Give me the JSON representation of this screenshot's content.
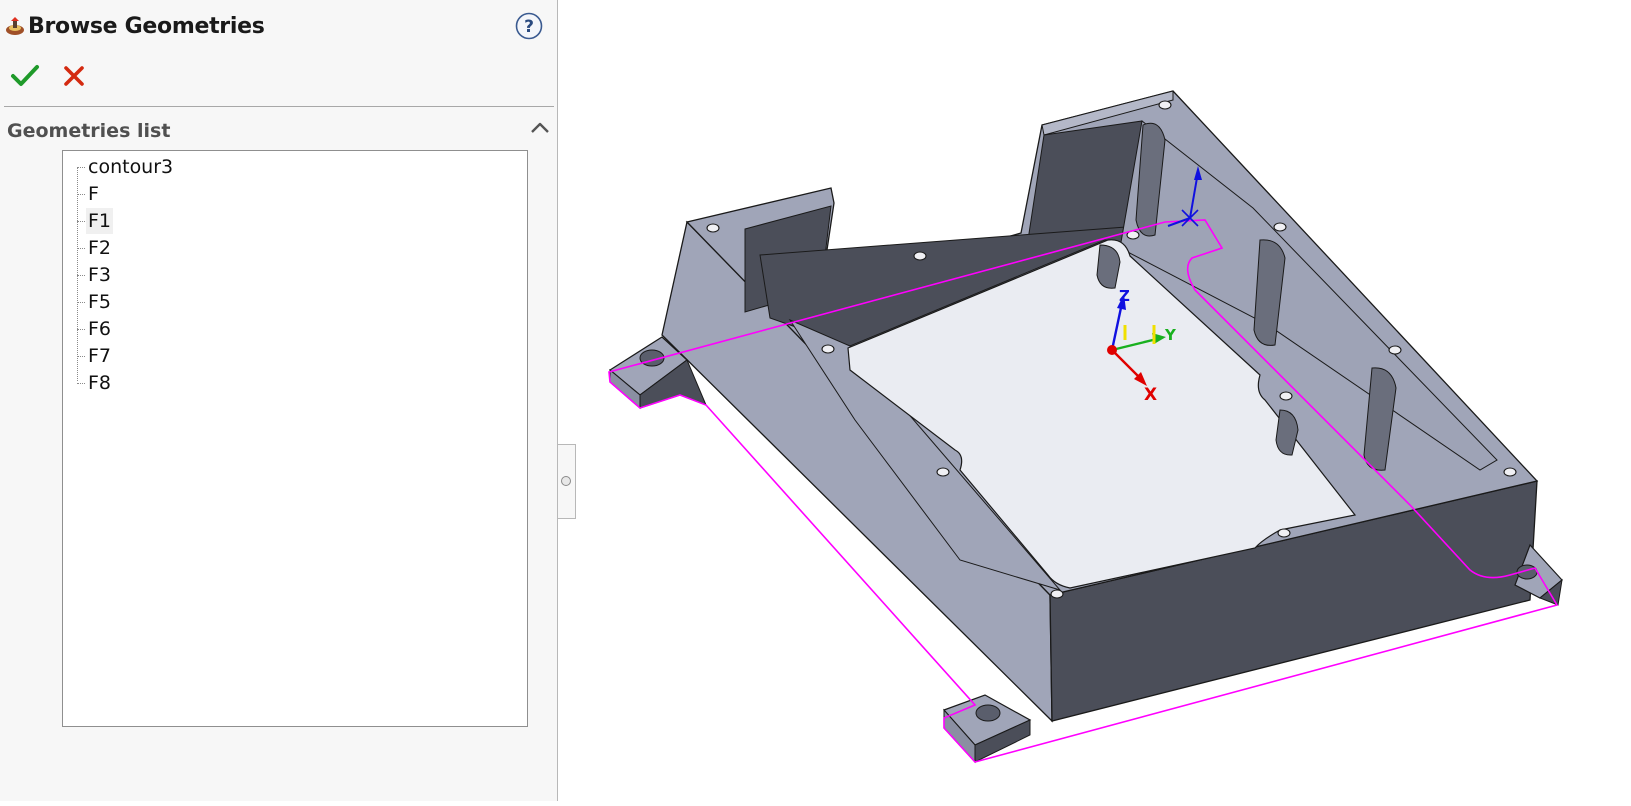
{
  "panel": {
    "title": "Browse Geometries",
    "icons": {
      "app": "camworks-icon",
      "help": "help-icon",
      "ok": "checkmark-icon",
      "cancel": "close-icon",
      "collapse": "chevron-up-icon"
    },
    "section_title": "Geometries list",
    "geometries": [
      "contour3",
      "F",
      "F1",
      "F2",
      "F3",
      "F5",
      "F6",
      "F7",
      "F8"
    ],
    "selected_geometry": "F1"
  },
  "viewport": {
    "axes": {
      "x": "X",
      "y": "Y",
      "z": "Z"
    },
    "colors": {
      "face_light": "#a0a5b8",
      "face_dark": "#4b4e59",
      "floor": "#eaecf2",
      "contour": "#ff00ff",
      "axis_x": "#e00000",
      "axis_y": "#19b01f",
      "axis_z": "#1010e0"
    }
  }
}
